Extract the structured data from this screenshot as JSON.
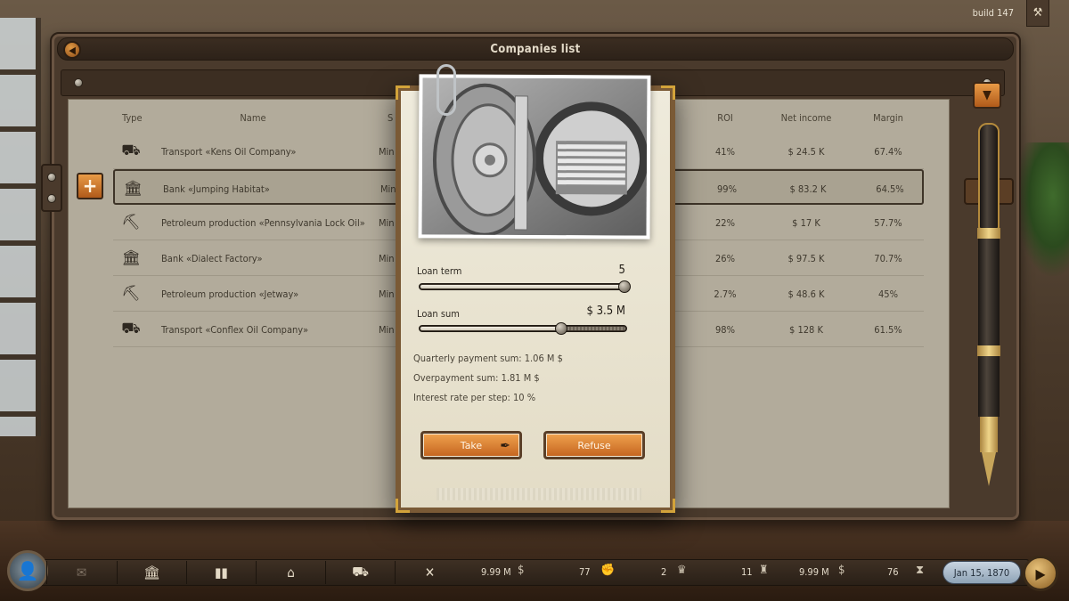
{
  "build_label": "build 147",
  "panel": {
    "title": "Companies list"
  },
  "table": {
    "headers": {
      "type": "Type",
      "name": "Name",
      "col3": "S",
      "roi": "ROI",
      "net_income": "Net income",
      "margin": "Margin"
    },
    "rows": [
      {
        "icon": "tanker-truck-icon",
        "glyph": "⛟",
        "name": "Transport «Kens Oil Company»",
        "col3": "Min",
        "roi": "41%",
        "net_income": "$ 24.5 K",
        "margin": "67.4%"
      },
      {
        "icon": "bank-icon",
        "glyph": "🏛",
        "name": "Bank «Jumping Habitat»",
        "col3": "Min",
        "roi": "99%",
        "net_income": "$ 83.2 K",
        "margin": "64.5%"
      },
      {
        "icon": "oil-pump-icon",
        "glyph": "⛏",
        "name": "Petroleum production «Pennsylvania Lock Oil»",
        "col3": "Min",
        "roi": "22%",
        "net_income": "$ 17 K",
        "margin": "57.7%"
      },
      {
        "icon": "bank-icon",
        "glyph": "🏛",
        "name": "Bank «Dialect Factory»",
        "col3": "Min",
        "roi": "26%",
        "net_income": "$ 97.5 K",
        "margin": "70.7%"
      },
      {
        "icon": "oil-pump-icon",
        "glyph": "⛏",
        "name": "Petroleum production «Jetway»",
        "col3": "Min",
        "roi": "2.7%",
        "net_income": "$ 48.6 K",
        "margin": "45%"
      },
      {
        "icon": "tanker-truck-icon",
        "glyph": "⛟",
        "name": "Transport «Conflex Oil Company»",
        "col3": "Min",
        "roi": "98%",
        "net_income": "$ 128 K",
        "margin": "61.5%"
      }
    ]
  },
  "loan": {
    "term_label": "Loan term",
    "term_value": "5",
    "term_fraction": 1.0,
    "sum_label": "Loan sum",
    "sum_value": "$ 3.5 M",
    "sum_fraction": 0.69,
    "quarterly_payment": "Quarterly payment sum: 1.06 M $",
    "overpayment": "Overpayment sum: 1.81 M $",
    "interest_rate": "Interest rate per step: 10 %",
    "take_label": "Take",
    "refuse_label": "Refuse"
  },
  "bottom_bar": {
    "stats": {
      "money_1": "9.99 M",
      "stat_2": "77",
      "stat_3": "2",
      "stat_4": "11",
      "money_2": "9.99 M",
      "stat_6": "76"
    },
    "date": "Jan 15, 1870"
  },
  "colors": {
    "accent_orange": "#e89a46",
    "panel_brown": "#4a3a2c",
    "table_bg": "#b2ab9b",
    "paper": "#efebdc"
  }
}
